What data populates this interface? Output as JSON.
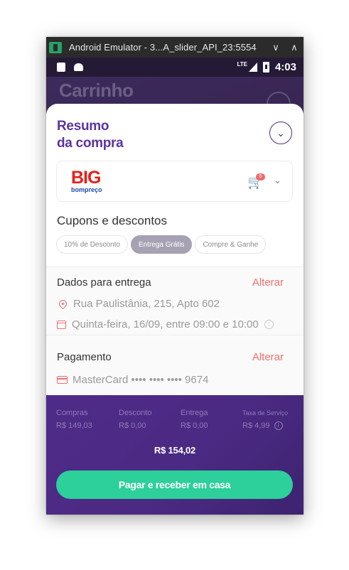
{
  "window": {
    "title": "Android Emulator - 3...A_slider_API_23:5554",
    "minimize_glyph": "∨",
    "maximize_glyph": "∧"
  },
  "statusbar": {
    "network": "LTE",
    "time": "4:03"
  },
  "app": {
    "page_title": "Carrinho",
    "summary": {
      "title_line1": "Resumo",
      "title_line2": "da compra"
    },
    "store": {
      "brand": "BIG",
      "sub_brand": "bompreço",
      "cart_count": "6"
    },
    "coupons": {
      "title": "Cupons e descontos",
      "chips": [
        {
          "label": "10% de Desconto",
          "active": false
        },
        {
          "label": "Entrega Grátis",
          "active": true
        },
        {
          "label": "Compre & Ganhe",
          "active": false
        }
      ]
    },
    "delivery": {
      "title": "Dados para entrega",
      "edit_label": "Alterar",
      "address": "Rua Paulistânia, 215, Apto 602",
      "schedule": "Quinta-feira, 16/09, entre 09:00 e 10:00"
    },
    "payment": {
      "title": "Pagamento",
      "edit_label": "Alterar",
      "card": "MasterCard •••• •••• •••• 9674"
    },
    "totals": {
      "compras_label": "Compras",
      "compras_value": "R$ 149,03",
      "desconto_label": "Desconto",
      "desconto_value": "R$ 0,00",
      "entrega_label": "Entrega",
      "entrega_value": "R$ 0,00",
      "taxa_label": "Taxa de Serviço",
      "taxa_value": "R$ 4,99",
      "total": "R$ 154,02"
    },
    "pay_button": "Pagar e receber em casa"
  },
  "colors": {
    "primary_purple": "#5b34a0",
    "accent_red": "#f07070",
    "pay_green": "#2dcf9b",
    "footer_purple": "#4e2b88"
  }
}
